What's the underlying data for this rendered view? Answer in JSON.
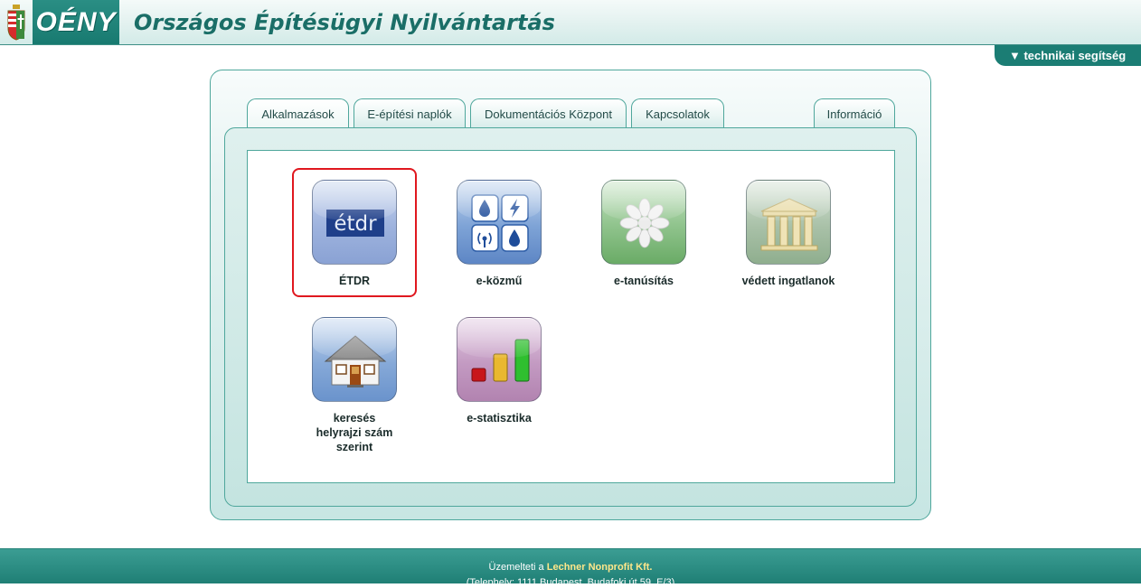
{
  "header": {
    "logo": "OÉNY",
    "title": "Országos Építésügyi Nyilvántartás",
    "help_link": "▼ technikai segítség"
  },
  "tabs": [
    {
      "label": "Alkalmazások",
      "active": true
    },
    {
      "label": "E-építési naplók"
    },
    {
      "label": "Dokumentációs Központ"
    },
    {
      "label": "Kapcsolatok"
    },
    {
      "label": "Információ"
    }
  ],
  "apps": [
    {
      "label": "ÉTDR",
      "icon": "etdr-logo-icon",
      "selected": true
    },
    {
      "label": "e-közmű",
      "icon": "utilities-icon"
    },
    {
      "label": "e-tanúsítás",
      "icon": "certificate-flower-icon"
    },
    {
      "label": "védett ingatlanok",
      "icon": "building-columns-icon"
    },
    {
      "label_lines": [
        "keresés",
        "helyrajzi szám",
        "szerint"
      ],
      "icon": "house-icon"
    },
    {
      "label": "e-statisztika",
      "icon": "bar-chart-icon"
    }
  ],
  "footer": {
    "prefix": "Üzemelteti a ",
    "org": "Lechner Nonprofit Kft.",
    "address": "(Telephely: 1111 Budapest, Budafoki út 59. E/3)"
  },
  "colors": {
    "brand": "#1b7d74",
    "highlight": "#e0181f"
  }
}
